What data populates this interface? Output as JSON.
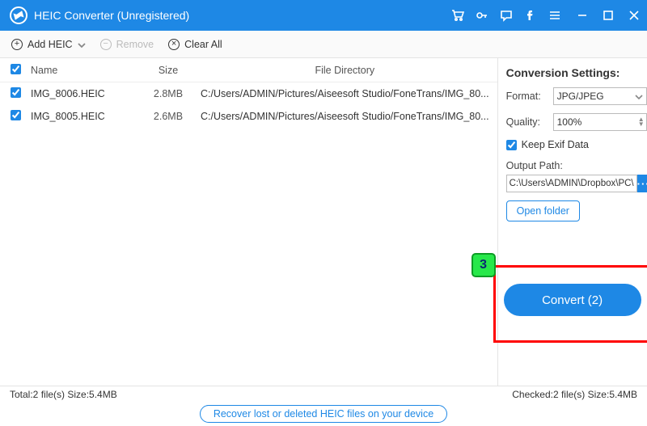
{
  "titlebar": {
    "title": "HEIC Converter (Unregistered)"
  },
  "toolbar": {
    "add_label": "Add HEIC",
    "remove_label": "Remove",
    "clear_label": "Clear All"
  },
  "columns": {
    "name": "Name",
    "size": "Size",
    "dir": "File Directory"
  },
  "files": [
    {
      "name": "IMG_8006.HEIC",
      "size": "2.8MB",
      "dir": "C:/Users/ADMIN/Pictures/Aiseesoft Studio/FoneTrans/IMG_80..."
    },
    {
      "name": "IMG_8005.HEIC",
      "size": "2.6MB",
      "dir": "C:/Users/ADMIN/Pictures/Aiseesoft Studio/FoneTrans/IMG_80..."
    }
  ],
  "settings": {
    "title": "Conversion Settings:",
    "format_label": "Format:",
    "format_value": "JPG/JPEG",
    "quality_label": "Quality:",
    "quality_value": "100%",
    "keep_exif_label": "Keep Exif Data",
    "output_label": "Output Path:",
    "output_value": "C:\\Users\\ADMIN\\Dropbox\\PC\\",
    "open_folder_label": "Open folder",
    "convert_label": "Convert (2)"
  },
  "annotation_badge": "3",
  "status": {
    "total": "Total:2 file(s) Size:5.4MB",
    "checked": "Checked:2 file(s) Size:5.4MB"
  },
  "footer_link": "Recover lost or deleted HEIC files on your device"
}
